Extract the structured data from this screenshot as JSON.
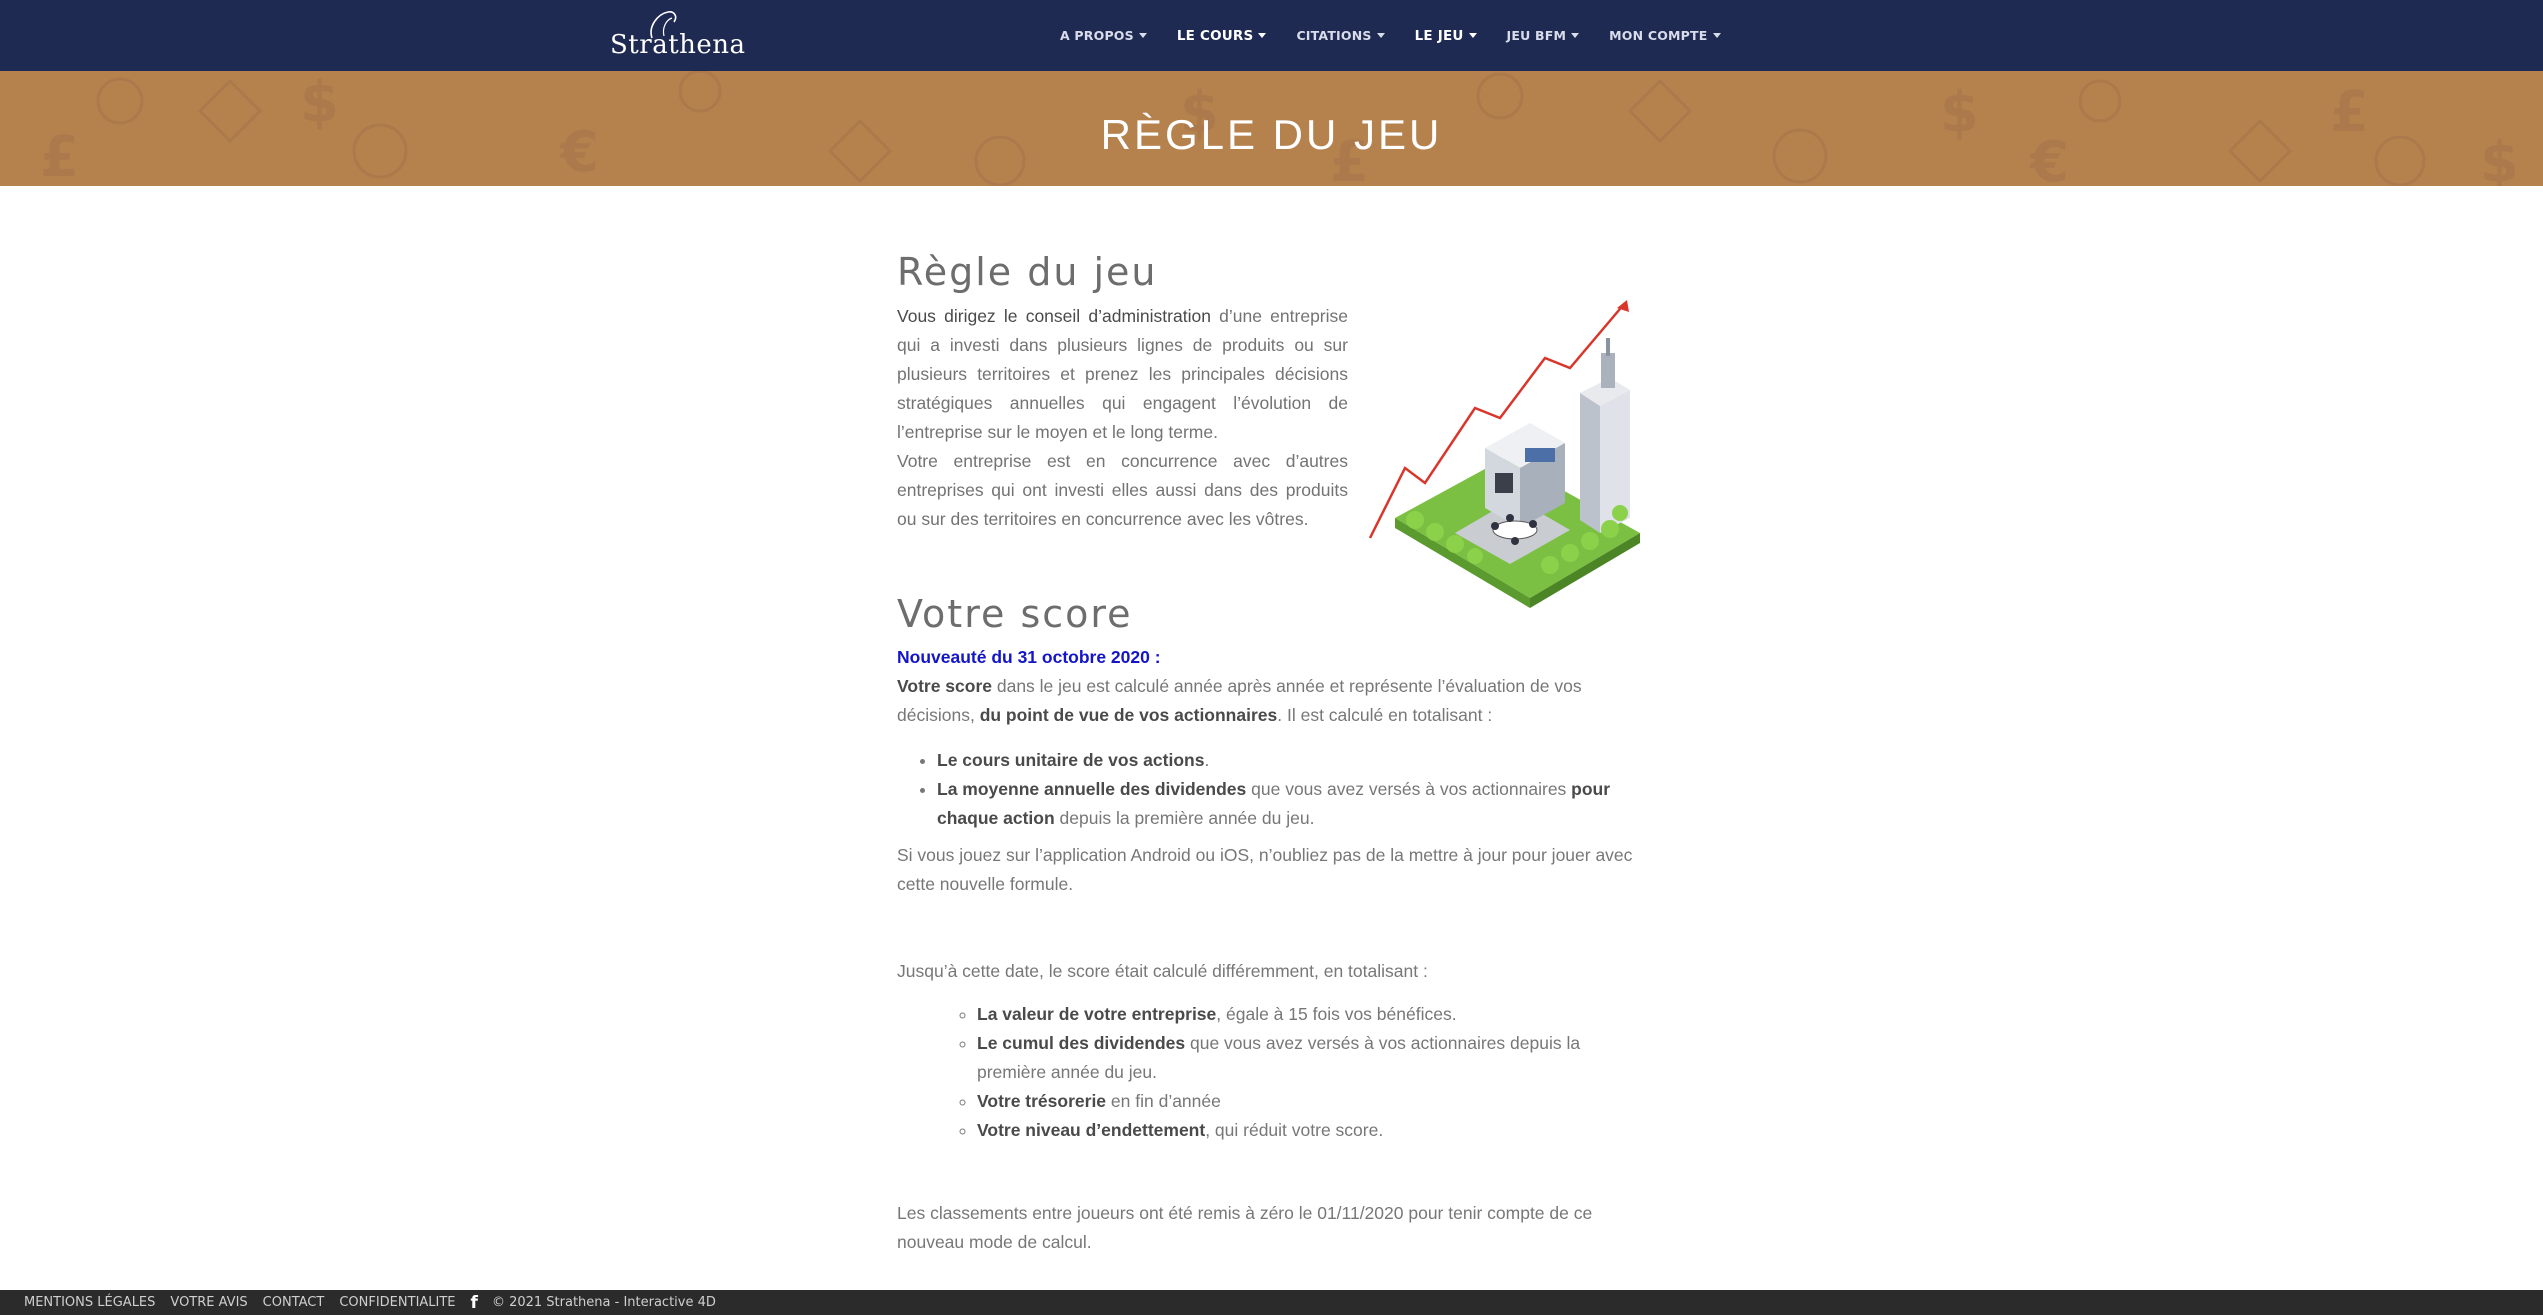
{
  "brand": {
    "name": "Strathena"
  },
  "nav": {
    "items": [
      {
        "label": "A PROPOS"
      },
      {
        "label": "LE COURS"
      },
      {
        "label": "CITATIONS"
      },
      {
        "label": "LE JEU"
      },
      {
        "label": "JEU BFM"
      },
      {
        "label": "MON COMPTE"
      }
    ]
  },
  "banner": {
    "title": "RÈGLE DU JEU"
  },
  "section1": {
    "title": "Règle du jeu",
    "p1_bold": "Vous dirigez le conseil d’administration",
    "p1_rest": " d’une entreprise qui a investi dans plusieurs lignes de produits ou sur plusieurs territoires et prenez les principales décisions stratégiques annuelles qui engagent l’évolution de l’entreprise sur le moyen et le long terme.",
    "p2": "Votre entreprise est en concurrence avec d’autres entreprises qui ont investi elles aussi dans des produits ou sur des territoires en concurrence avec les vôtres."
  },
  "section2": {
    "title": "Votre score",
    "news": "Nouveauté du 31 octobre 2020 :",
    "score_b1": "Votre score",
    "score_t1": " dans le jeu est calculé année après année et représente l’évaluation de vos décisions, ",
    "score_b2": "du point de vue de vos actionnaires",
    "score_t2": ". Il est calculé en totalisant :",
    "list1": [
      {
        "bold": "Le cours unitaire de vos actions",
        "text": "."
      },
      {
        "bold": "La moyenne annuelle des dividendes",
        "text": " que vous avez versés à vos actionnaires ",
        "bold2": "pour chaque action",
        "text2": " depuis la première année du jeu."
      }
    ],
    "app_note": "Si vous jouez sur l’application Android ou iOS, n’oubliez pas de la mettre à jour pour jouer avec cette nouvelle formule.",
    "before_note": "Jusqu’à cette date, le score était calculé différemment, en totalisant :",
    "list2": [
      {
        "bold": "La valeur de votre entreprise",
        "text": ", égale à 15 fois vos bénéfices."
      },
      {
        "bold": "Le cumul des dividendes",
        "text": " que vous avez versés à vos actionnaires depuis la première année du jeu."
      },
      {
        "bold": "Votre trésorerie",
        "text": " en fin d’année"
      },
      {
        "bold": "Votre niveau d’endettement",
        "text": ", qui réduit votre score."
      }
    ],
    "reset_note": "Les classements entre joueurs ont été remis à zéro le 01/11/2020 pour tenir compte de ce nouveau mode de calcul."
  },
  "footer": {
    "links": [
      "MENTIONS LÉGALES",
      "VOTRE AVIS",
      "CONTACT",
      "CONFIDENTIALITE"
    ],
    "facebook": "f",
    "copyright": "© 2021 Strathena - Interactive 4D"
  }
}
